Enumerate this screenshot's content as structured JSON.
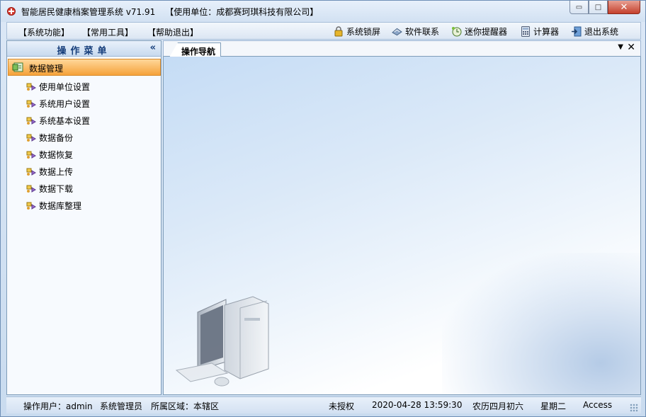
{
  "titlebar": {
    "app_name": "智能居民健康档案管理系统 v71.91",
    "unit": "【使用单位：成都赛珂琪科技有限公司】",
    "min_glyph": "▭",
    "max_glyph": "□",
    "close_glyph": "✕"
  },
  "menu": {
    "system_functions": "【系统功能】",
    "common_tools": "【常用工具】",
    "help_exit": "【帮助退出】"
  },
  "toolbar": {
    "lock": "系统锁屏",
    "contact": "软件联系",
    "reminder": "迷你提醒器",
    "calculator": "计算器",
    "exit": "退出系统"
  },
  "sidebar": {
    "title": "操作菜单",
    "collapse_glyph": "«",
    "group": "数据管理",
    "items": [
      {
        "label": "使用单位设置"
      },
      {
        "label": "系统用户设置"
      },
      {
        "label": "系统基本设置"
      },
      {
        "label": "数据备份"
      },
      {
        "label": "数据恢复"
      },
      {
        "label": "数据上传"
      },
      {
        "label": "数据下载"
      },
      {
        "label": "数据库整理"
      }
    ]
  },
  "tabs": {
    "active": "操作导航",
    "dropdown_glyph": "▼",
    "close_glyph": "✕"
  },
  "status": {
    "user": "操作用户：admin",
    "role": "系统管理员",
    "region": "所属区域：本辖区",
    "license": "未授权",
    "datetime": "2020-04-28 13:59:30",
    "lunar": "农历四月初六",
    "weekday": "星期二",
    "db": "Access"
  },
  "colors": {
    "accent": "#f5a23a",
    "header_text": "#153d7a"
  }
}
